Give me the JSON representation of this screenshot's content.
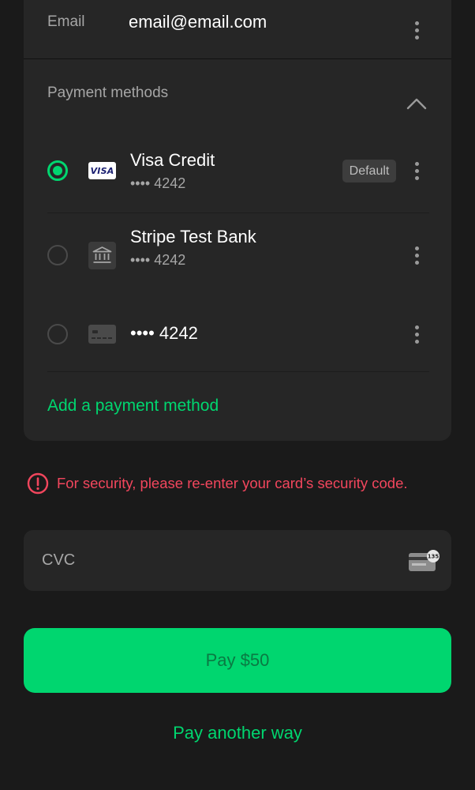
{
  "email": {
    "label": "Email",
    "value": "email@email.com",
    "menu_icon": "more-vertical-icon"
  },
  "payment_methods": {
    "header": "Payment methods",
    "collapse_icon": "chevron-up-icon",
    "items": [
      {
        "name": "Visa Credit",
        "last4": "•••• 4242",
        "brand": "VISA",
        "brand_icon": "visa-card-icon",
        "selected": true,
        "badge": "Default"
      },
      {
        "name": "Stripe Test Bank",
        "last4": "•••• 4242",
        "brand_icon": "bank-icon",
        "selected": false
      },
      {
        "name": "•••• 4242",
        "brand_icon": "generic-card-icon",
        "selected": false
      }
    ],
    "add_label": "Add a payment method"
  },
  "security_error": {
    "icon": "alert-circle-icon",
    "text": "For security, please re-enter your card’s security code."
  },
  "cvc": {
    "placeholder": "CVC",
    "value": "",
    "icon": "cvc-card-icon",
    "icon_text": "135"
  },
  "pay_button": {
    "label": "Pay $50"
  },
  "pay_another": {
    "label": "Pay another way"
  },
  "colors": {
    "background": "#1a1a1a",
    "surface": "#262626",
    "accent": "#00d66f",
    "error": "#f2465d",
    "muted_text": "#a6a6a6"
  }
}
